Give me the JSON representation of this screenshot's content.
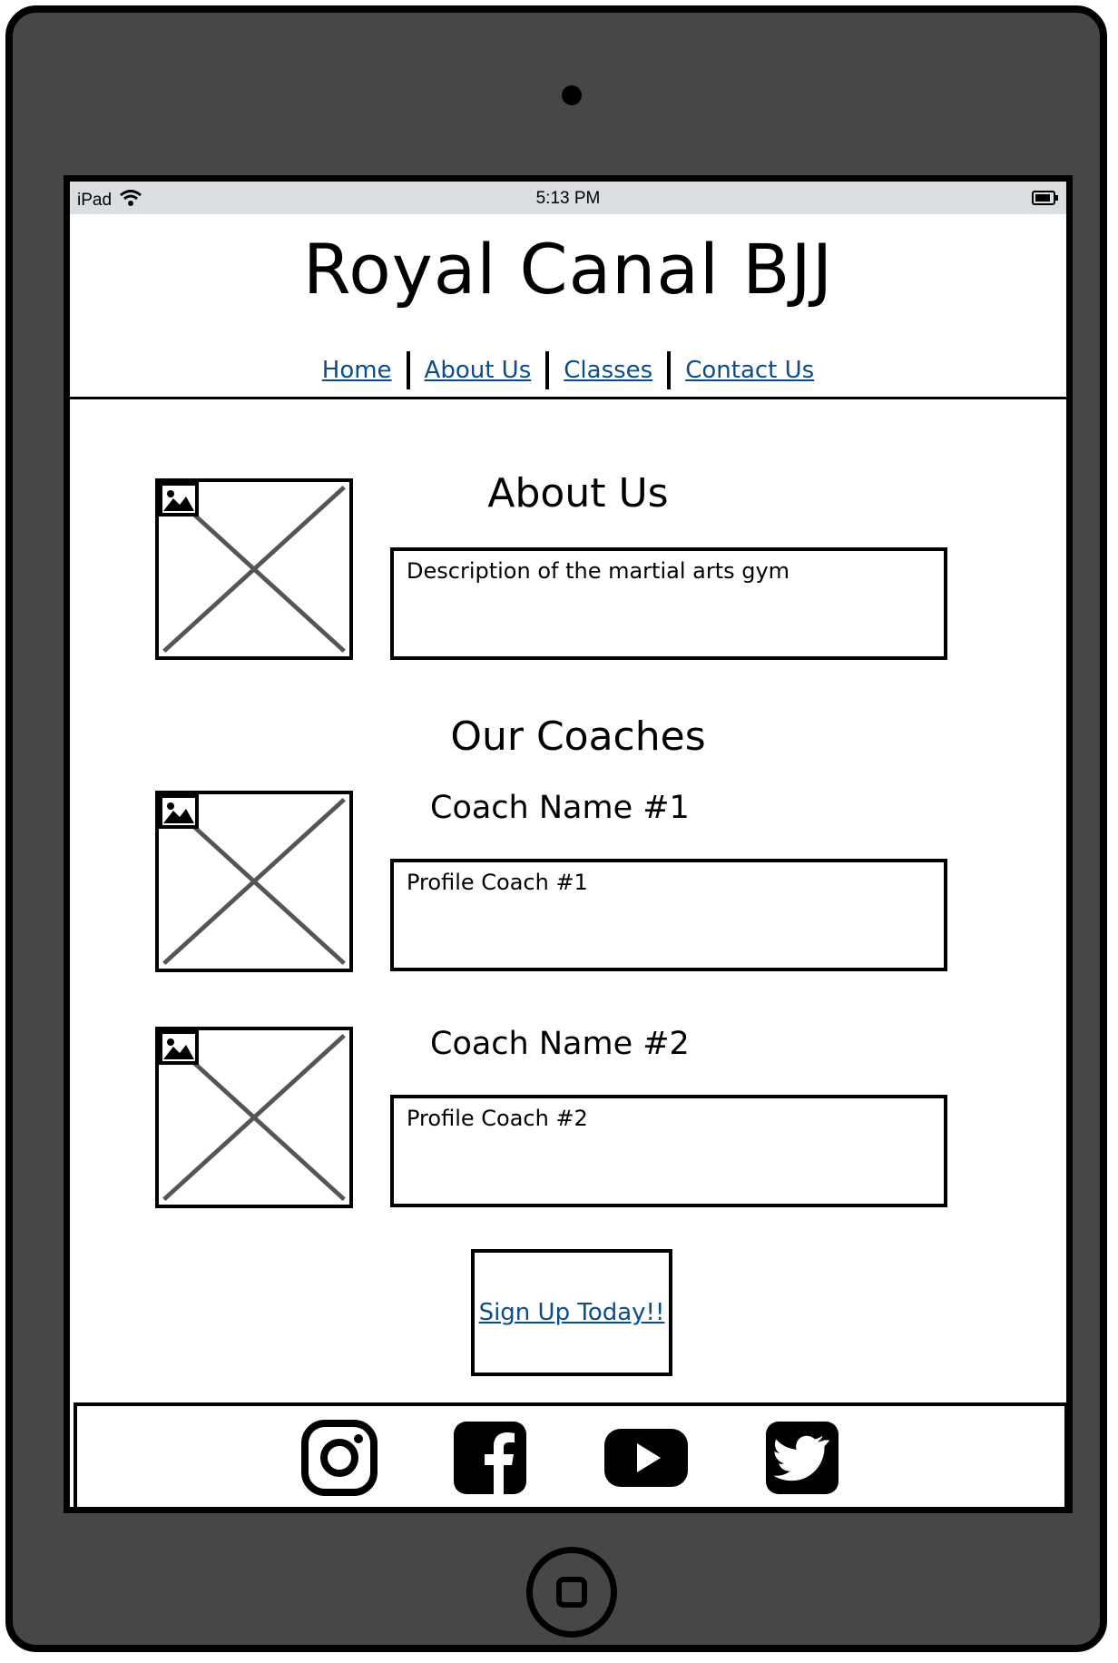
{
  "status_bar": {
    "device": "iPad",
    "time": "5:13 PM"
  },
  "site": {
    "title": "Royal Canal BJJ"
  },
  "nav": {
    "items": [
      "Home",
      "About Us",
      "Classes",
      "Contact Us"
    ]
  },
  "about": {
    "heading": "About Us",
    "description": "Description of the martial arts gym"
  },
  "coaches": {
    "heading": "Our Coaches",
    "list": [
      {
        "name": "Coach Name #1",
        "profile": "Profile Coach #1"
      },
      {
        "name": "Coach Name #2",
        "profile": "Profile Coach #2"
      }
    ]
  },
  "cta": {
    "label": "Sign Up Today!!"
  },
  "footer": {
    "social_icons": [
      "instagram-icon",
      "facebook-icon",
      "youtube-icon",
      "twitter-icon"
    ]
  },
  "colors": {
    "link": "#0a4d8c",
    "device_body": "#474747",
    "status_bar": "#dadee1"
  }
}
